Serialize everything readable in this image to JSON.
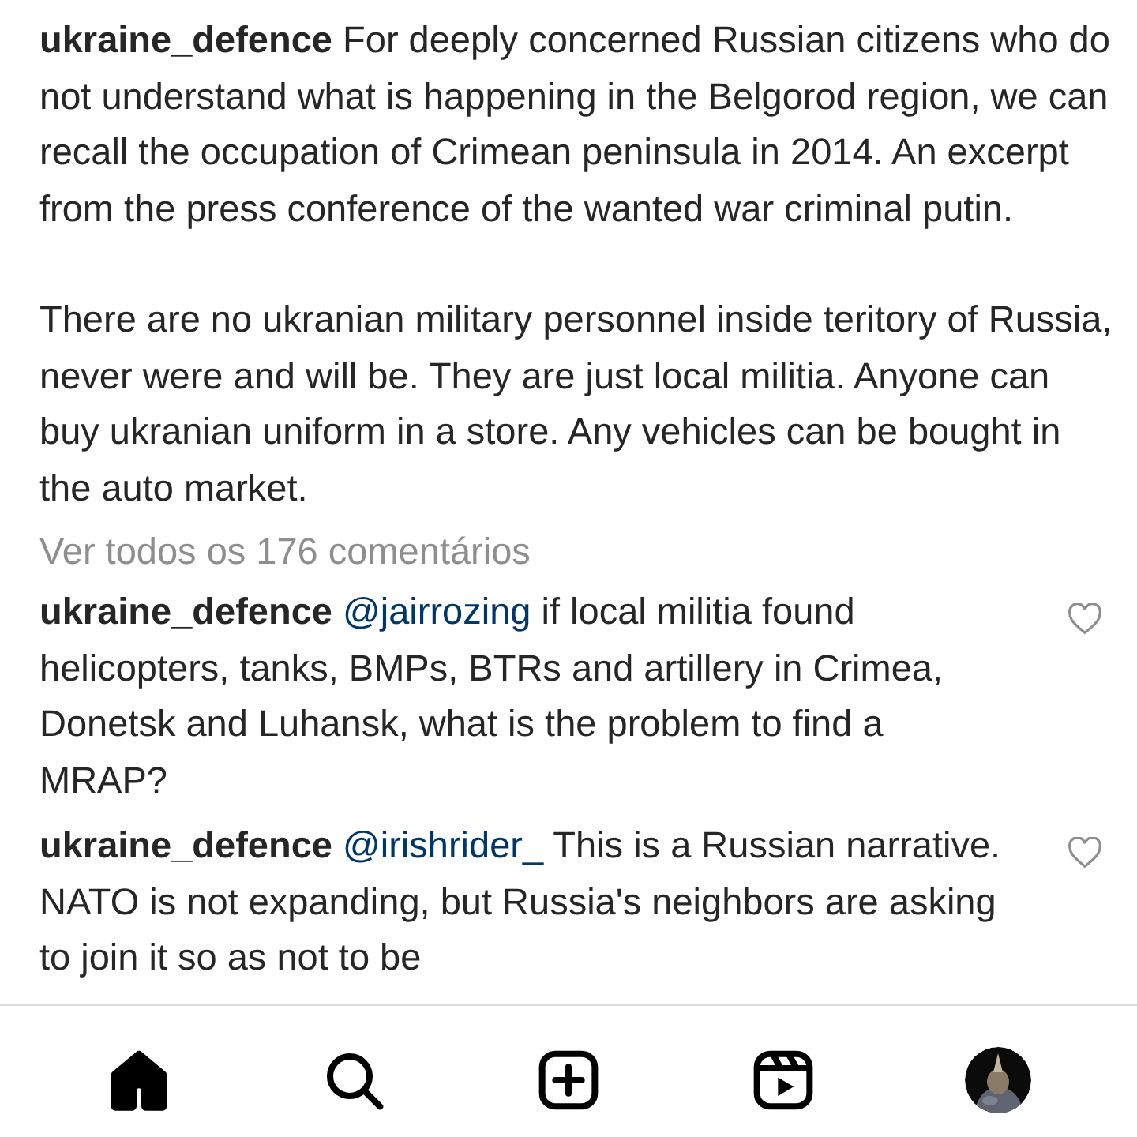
{
  "caption": {
    "username": "ukraine_defence",
    "paragraphs": [
      "For deeply concerned Russian citizens who do not understand what is happening in the Belgorod region, we can recall the occupation of Crimean peninsula in 2014. An excerpt from the press conference of the wanted war criminal putin.",
      "There are no ukranian military personnel inside teritory of Russia, never were and will be. They are just local militia. Anyone can buy ukranian uniform in a store. Any vehicles can be bought in the auto market."
    ]
  },
  "view_all_comments": "Ver todos os 176 comentários",
  "comments": [
    {
      "username": "ukraine_defence",
      "mention": "@jairrozing",
      "text": "if local militia found helicopters, tanks, BMPs, BTRs and artillery in Crimea, Donetsk and Luhansk, what is the problem to find a MRAP?",
      "liked": false
    },
    {
      "username": "ukraine_defence",
      "mention": "@irishrider_",
      "text": "This is a Russian narrative. NATO is not expanding, but Russia's neighbors are asking to join it so as not to be",
      "liked": false
    }
  ],
  "nav": [
    {
      "kind": "home",
      "selected": true
    },
    {
      "kind": "search",
      "selected": false
    },
    {
      "kind": "create",
      "selected": false
    },
    {
      "kind": "reels",
      "selected": false
    },
    {
      "kind": "profile",
      "selected": false
    }
  ]
}
